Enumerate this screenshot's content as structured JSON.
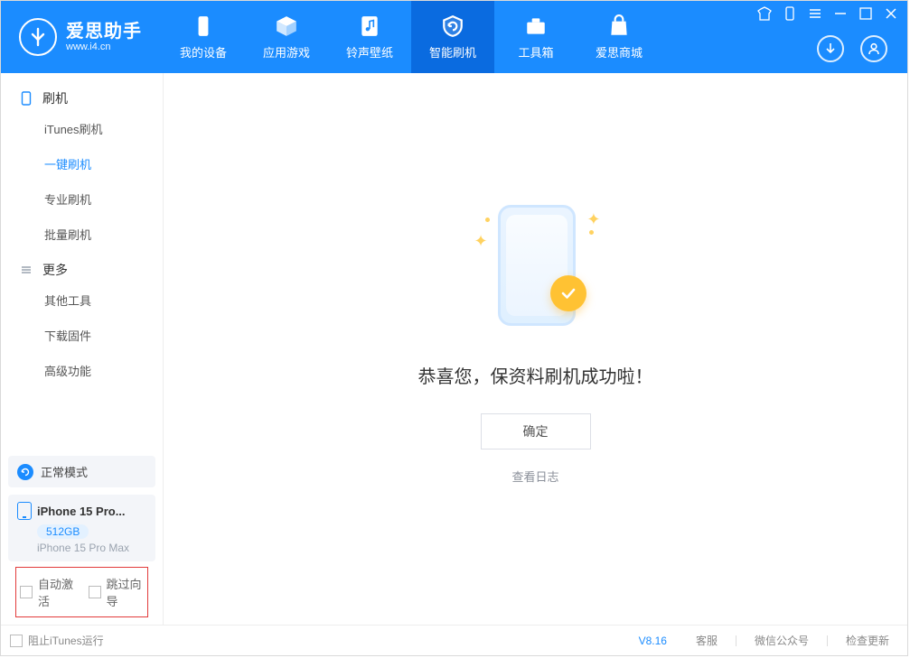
{
  "brand": {
    "title": "爱思助手",
    "subtitle": "www.i4.cn"
  },
  "nav": {
    "items": [
      {
        "label": "我的设备"
      },
      {
        "label": "应用游戏"
      },
      {
        "label": "铃声壁纸"
      },
      {
        "label": "智能刷机"
      },
      {
        "label": "工具箱"
      },
      {
        "label": "爱思商城"
      }
    ],
    "active_index": 3
  },
  "sidebar": {
    "group1": {
      "title": "刷机",
      "items": [
        "iTunes刷机",
        "一键刷机",
        "专业刷机",
        "批量刷机"
      ],
      "active": 1
    },
    "group2": {
      "title": "更多",
      "items": [
        "其他工具",
        "下载固件",
        "高级功能"
      ]
    }
  },
  "mode": {
    "label": "正常模式"
  },
  "device": {
    "name": "iPhone 15 Pro...",
    "capacity": "512GB",
    "full_name": "iPhone 15 Pro Max"
  },
  "options": {
    "auto_activate": "自动激活",
    "skip_wizard": "跳过向导"
  },
  "main": {
    "success_title": "恭喜您，保资料刷机成功啦！",
    "ok_button": "确定",
    "view_log": "查看日志"
  },
  "status": {
    "block_itunes": "阻止iTunes运行",
    "version": "V8.16",
    "links": [
      "客服",
      "微信公众号",
      "检查更新"
    ]
  }
}
